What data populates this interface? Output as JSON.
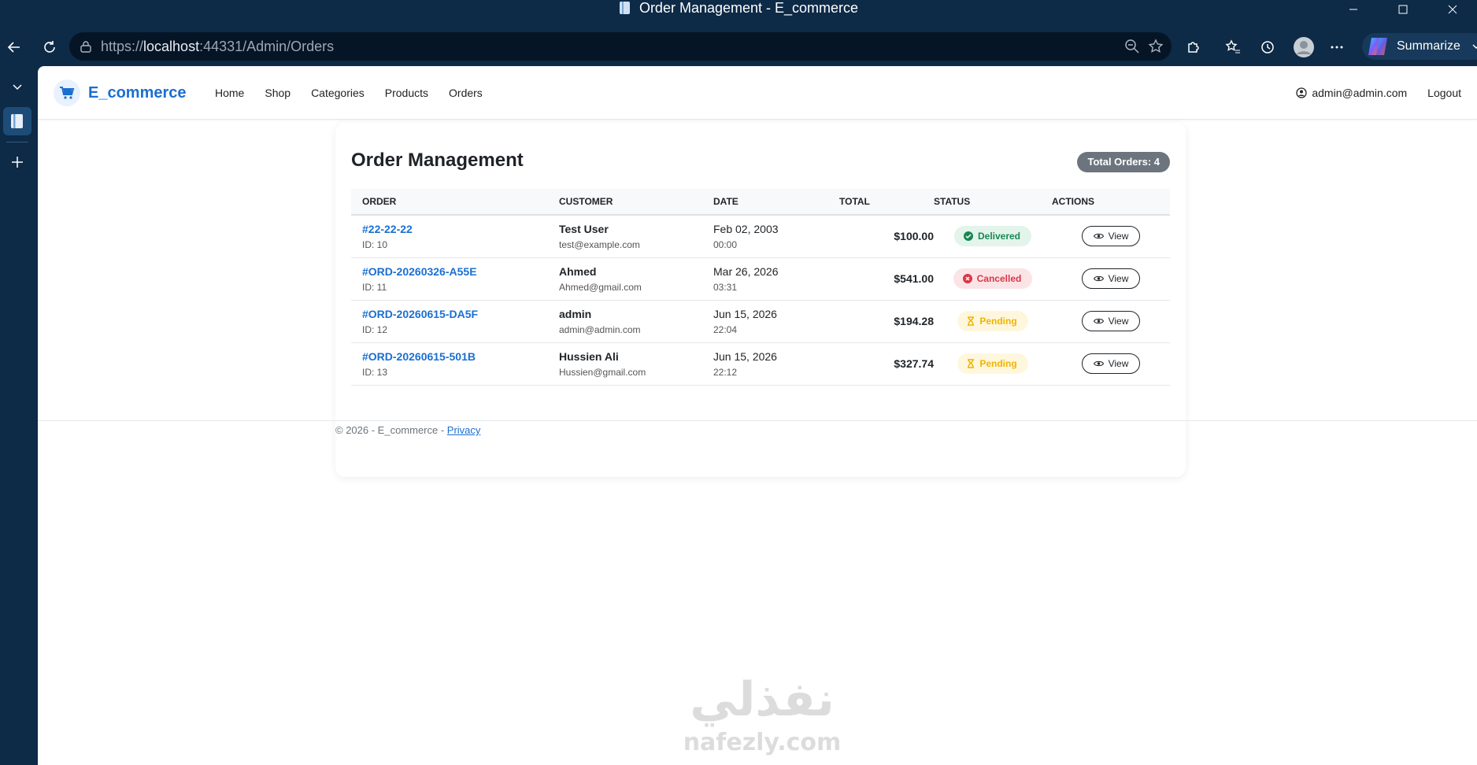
{
  "window": {
    "title": "Order Management - E_commerce"
  },
  "browser": {
    "url_prefix": "https://",
    "url_host": "localhost",
    "url_rest": ":44331/Admin/Orders",
    "summarize_label": "Summarize"
  },
  "site": {
    "brand": "E_commerce",
    "nav": [
      "Home",
      "Shop",
      "Categories",
      "Products",
      "Orders"
    ],
    "user_email": "admin@admin.com",
    "logout_label": "Logout",
    "accent_color": "#1a6fd1"
  },
  "orders_page": {
    "title": "Order Management",
    "total_label": "Total Orders: 4",
    "columns": {
      "order": "Order",
      "customer": "Customer",
      "date": "Date",
      "total": "Total",
      "status": "Status",
      "actions": "Actions"
    },
    "view_label": "View",
    "rows": [
      {
        "order_no": "#22-22-22",
        "id": "ID: 10",
        "customer_name": "Test User",
        "customer_email": "test@example.com",
        "date": "Feb 02, 2003",
        "time": "00:00",
        "total": "$100.00",
        "status": "Delivered",
        "status_type": "delivered"
      },
      {
        "order_no": "#ORD-20260326-A55E",
        "id": "ID: 11",
        "customer_name": "Ahmed",
        "customer_email": "Ahmed@gmail.com",
        "date": "Mar 26, 2026",
        "time": "03:31",
        "total": "$541.00",
        "status": "Cancelled",
        "status_type": "cancelled"
      },
      {
        "order_no": "#ORD-20260615-DA5F",
        "id": "ID: 12",
        "customer_name": "admin",
        "customer_email": "admin@admin.com",
        "date": "Jun 15, 2026",
        "time": "22:04",
        "total": "$194.28",
        "status": "Pending",
        "status_type": "pending"
      },
      {
        "order_no": "#ORD-20260615-501B",
        "id": "ID: 13",
        "customer_name": "Hussien Ali",
        "customer_email": "Hussien@gmail.com",
        "date": "Jun 15, 2026",
        "time": "22:12",
        "total": "$327.74",
        "status": "Pending",
        "status_type": "pending"
      }
    ]
  },
  "footer": {
    "text": "© 2026 - E_commerce - ",
    "privacy_label": "Privacy"
  },
  "watermark": {
    "arabic": "نفذلي",
    "latin": "nafezly.com"
  }
}
